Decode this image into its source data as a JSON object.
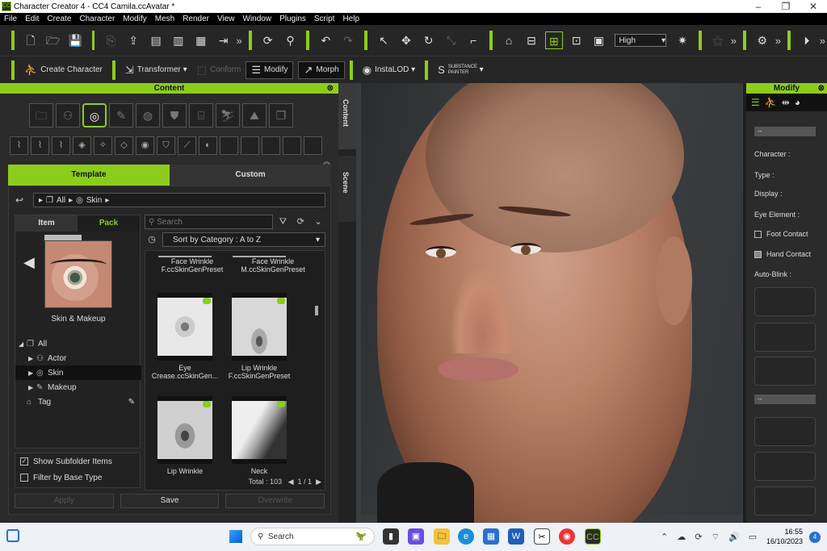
{
  "window": {
    "title": "Character Creator 4 - CC4 Camila.ccAvatar *",
    "minimize": "–",
    "maximize": "❐",
    "close": "✕"
  },
  "menu": [
    "File",
    "Edit",
    "Create",
    "Character",
    "Modify",
    "Mesh",
    "Render",
    "View",
    "Window",
    "Plugins",
    "Script",
    "Help"
  ],
  "toolbar1": {
    "quality_label": "High"
  },
  "toolbar2": {
    "create_character": "Create Character",
    "transformer": "Transformer",
    "conform": "Conform",
    "modify": "Modify",
    "morph": "Morph",
    "instalod": "InstaLOD",
    "substance": "SUBSTANCE PAINTER"
  },
  "content": {
    "header": "Content",
    "tab_template": "Template",
    "tab_custom": "Custom",
    "breadcrumb_all": "All",
    "breadcrumb_skin": "Skin",
    "tab_item": "Item",
    "tab_pack": "Pack",
    "preview_caption": "Skin & Makeup",
    "tree": [
      {
        "label": "All",
        "indent": 0,
        "arrow": "◢",
        "selected": false
      },
      {
        "label": "Actor",
        "indent": 1,
        "arrow": "▶",
        "selected": false
      },
      {
        "label": "Skin",
        "indent": 1,
        "arrow": "▶",
        "selected": true
      },
      {
        "label": "Makeup",
        "indent": 1,
        "arrow": "▶",
        "selected": false
      },
      {
        "label": "Tag",
        "indent": 0,
        "arrow": "",
        "selected": false
      }
    ],
    "show_subfolder": "Show Subfolder Items",
    "filter_base": "Filter by Base Type",
    "search_placeholder": "Search",
    "sort_label": "Sort by Category : A to Z",
    "grid_top": [
      "Face Wrinkle F.ccSkinGenPreset",
      "Face Wrinkle M.ccSkinGenPreset"
    ],
    "items": [
      {
        "caption": "Eye Crease.ccSkinGen..."
      },
      {
        "caption": "Lip Wrinkle F.ccSkinGenPreset"
      },
      {
        "caption": "Lip Wrinkle"
      },
      {
        "caption": "Neck"
      }
    ],
    "total": "Total : 103",
    "page": "1 / 1",
    "apply": "Apply",
    "save": "Save",
    "overwrite": "Overwrite"
  },
  "side_tabs": {
    "content": "Content",
    "scene": "Scene"
  },
  "modify": {
    "header": "Modify",
    "dash1": "--",
    "dash2": "--",
    "character": "Character :",
    "type": "Type :",
    "display": "Display :",
    "eye_element": "Eye Element :",
    "foot_contact": "Foot Contact",
    "hand_contact": "Hand Contact",
    "auto_blink": "Auto-Blink :"
  },
  "taskbar": {
    "search": "Search",
    "time": "16:55",
    "date": "16/10/2023",
    "notifications": "4"
  }
}
